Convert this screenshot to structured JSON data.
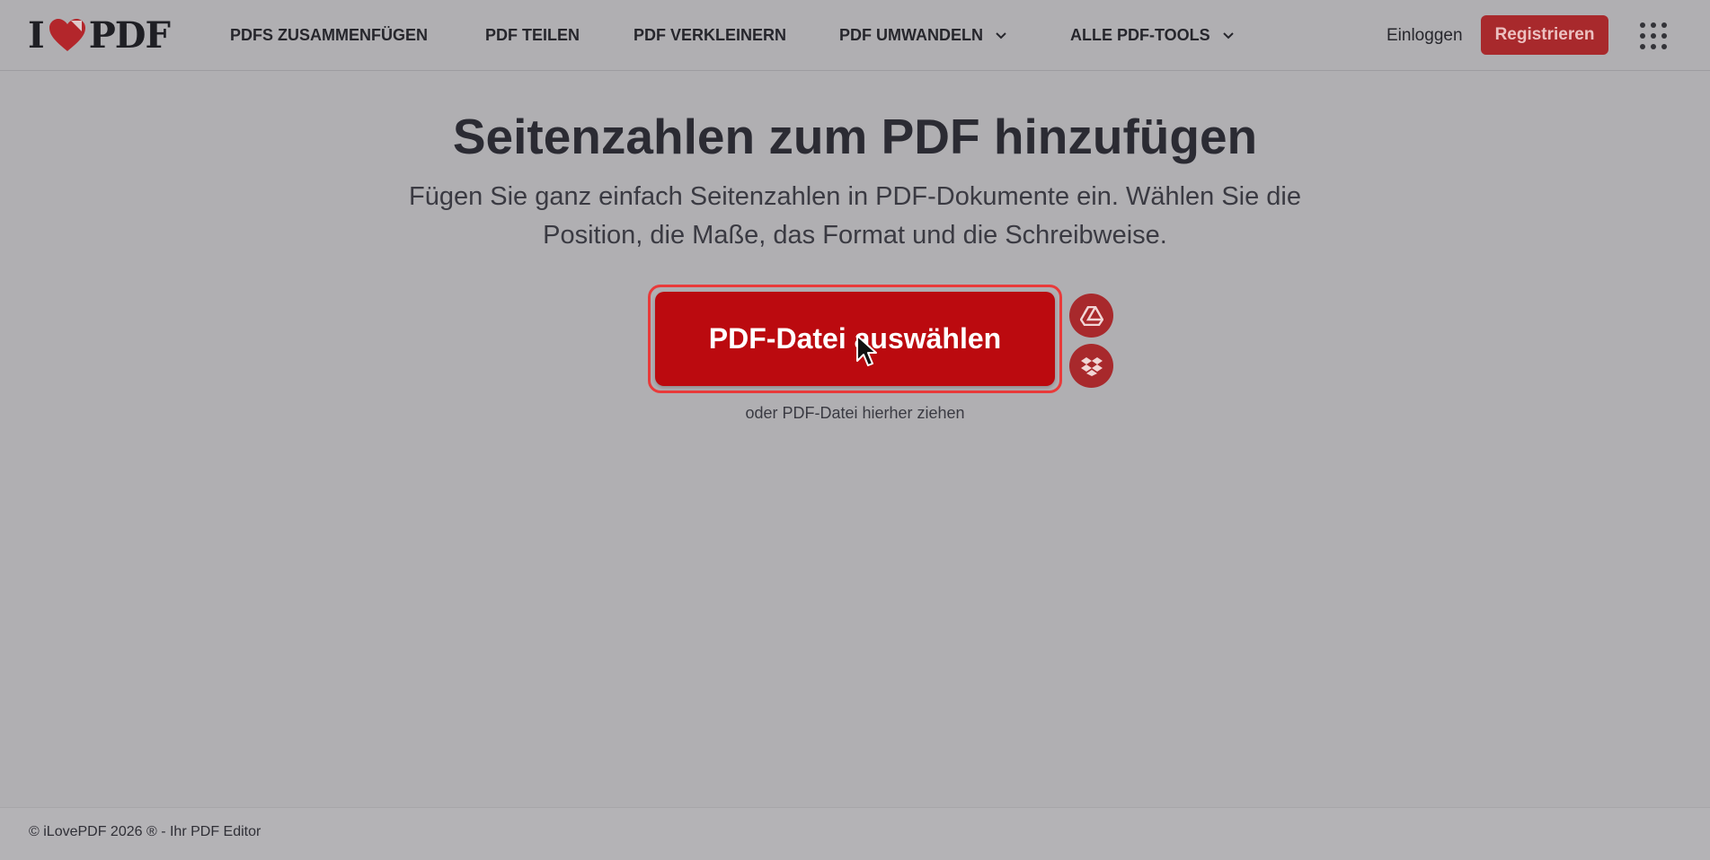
{
  "header": {
    "logo": {
      "left": "I",
      "right": "PDF"
    },
    "nav": [
      {
        "label": "PDFS ZUSAMMENFÜGEN",
        "dropdown": false
      },
      {
        "label": "PDF TEILEN",
        "dropdown": false
      },
      {
        "label": "PDF VERKLEINERN",
        "dropdown": false
      },
      {
        "label": "PDF UMWANDELN",
        "dropdown": true
      },
      {
        "label": "ALLE PDF-TOOLS",
        "dropdown": true
      }
    ],
    "login": "Einloggen",
    "register": "Registrieren"
  },
  "main": {
    "title": "Seitenzahlen zum PDF hinzufügen",
    "subtitle": "Fügen Sie ganz einfach Seitenzahlen in PDF-Dokumente ein. Wählen Sie die Position, die Maße, das Format und die Schreibweise.",
    "upload_button": "PDF-Datei auswählen",
    "cloud_buttons": [
      "google-drive-icon",
      "dropbox-icon"
    ],
    "drop_hint": "oder PDF-Datei hierher ziehen"
  },
  "footer": {
    "copyright": "© iLovePDF 2026 ® - Ihr PDF Editor"
  },
  "colors": {
    "brand_red": "#bb0a0f",
    "dim_red": "#a8292c",
    "overlay_bg": "#b0afb2"
  }
}
